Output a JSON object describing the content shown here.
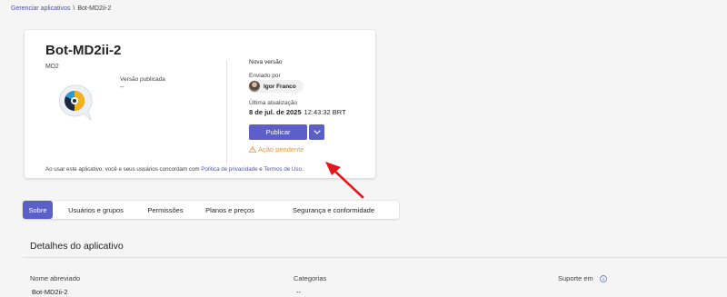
{
  "breadcrumb": {
    "parent": "Gerenciar aplicativos",
    "separator": "\\",
    "current": "Bot-MD2ii-2"
  },
  "app": {
    "name": "Bot-MD2ii-2",
    "subtitle": "MD2",
    "published_version_label": "Versão publicada",
    "published_version_value": "--"
  },
  "new_version": {
    "heading": "Nova versão",
    "sent_by_label": "Enviado por",
    "sent_by_name": "Igor Franco",
    "last_update_label": "Última atualização",
    "last_update_date": "8 de jul. de 2025",
    "last_update_time": "12:43:32 BRT",
    "publish_label": "Publicar",
    "pending_label": "Ação pendente"
  },
  "consent": {
    "prefix": "Ao usar este aplicativo, você e seus usuários concordam com ",
    "privacy_link": "Política de privacidade",
    "conjunction": " e ",
    "terms_link": "Termos de Uso",
    "suffix": "."
  },
  "tabs": [
    {
      "label": "Sobre",
      "active": true
    },
    {
      "label": "Usuários e grupos",
      "active": false
    },
    {
      "label": "Permissões",
      "active": false
    },
    {
      "label": "Planos e preços",
      "active": false
    },
    {
      "label": "Segurança e conformidade",
      "active": false
    }
  ],
  "details": {
    "title": "Detalhes do aplicativo",
    "short_name_label": "Nome abreviado",
    "short_name_value": "Bot-MD2ii-2",
    "categories_label": "Categorias",
    "categories_value": "--",
    "support_label": "Suporte em"
  },
  "colors": {
    "accent": "#5b5fc7",
    "link": "#4f52b2",
    "warning": "#e9973a",
    "annotation_arrow": "#e3161b"
  },
  "icons": {
    "app_logo": "app-logo-icon",
    "dropdown": "chevron-down-icon",
    "warning": "warning-icon",
    "info": "info-icon"
  }
}
